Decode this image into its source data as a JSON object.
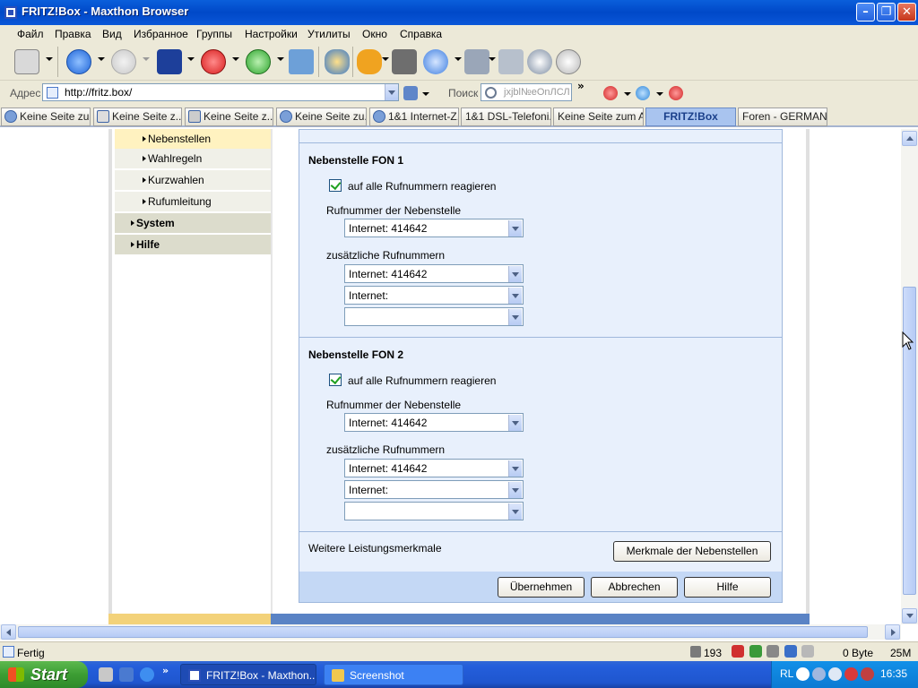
{
  "window": {
    "title": "FRITZ!Box - Maxthon Browser"
  },
  "menu": [
    "Файл",
    "Правка",
    "Вид",
    "Избранное",
    "Группы",
    "Настройки",
    "Утилиты",
    "Окно",
    "Справка"
  ],
  "address": {
    "label": "Адрес",
    "url": "http://fritz.box/"
  },
  "search": {
    "label": "Поиск",
    "query": "jxjbl№eOnЛСЛ"
  },
  "tabs": [
    "Keine Seite zu...",
    "Keine Seite z...",
    "Keine Seite z...",
    "Keine Seite zu...",
    "1&1 Internet-Z...",
    "1&1 DSL-Telefoni...",
    "Keine Seite zum A...",
    "FRITZ!Box",
    "Foren - GERMAN..."
  ],
  "nav": {
    "items": [
      {
        "label": "Nebenstellen"
      },
      {
        "label": "Wahlregeln"
      },
      {
        "label": "Kurzwahlen"
      },
      {
        "label": "Rufumleitung"
      },
      {
        "label": "System"
      },
      {
        "label": "Hilfe"
      }
    ]
  },
  "fon1": {
    "title": "Nebenstelle FON 1",
    "checkbox_label": "auf alle Rufnummern reagieren",
    "number_label": "Rufnummer der Nebenstelle",
    "number_value": "Internet: 414642",
    "extra_label": "zusätzliche Rufnummern",
    "extra": [
      "Internet: 414642",
      "Internet:",
      ""
    ]
  },
  "fon2": {
    "title": "Nebenstelle FON 2",
    "checkbox_label": "auf alle Rufnummern reagieren",
    "number_label": "Rufnummer der Nebenstelle",
    "number_value": "Internet: 414642",
    "extra_label": "zusätzliche Rufnummern",
    "extra": [
      "Internet: 414642",
      "Internet:",
      ""
    ]
  },
  "features": {
    "label": "Weitere Leistungsmerkmale",
    "button": "Merkmale der Nebenstellen"
  },
  "actions": {
    "apply": "Übernehmen",
    "cancel": "Abbrechen",
    "help": "Hilfe"
  },
  "status": {
    "text": "Fertig",
    "count": "193",
    "bytes": "0 Byte",
    "memory": "25M"
  },
  "taskbar": {
    "start": "Start",
    "items": [
      "FRITZ!Box - Maxthon...",
      "Screenshot"
    ],
    "lang": "RL",
    "clock": "16:35"
  },
  "colors": {
    "panel_bg": "#e8f0fc",
    "nav_selected": "#fff2c0",
    "active_tab": "#a9c4ef"
  }
}
